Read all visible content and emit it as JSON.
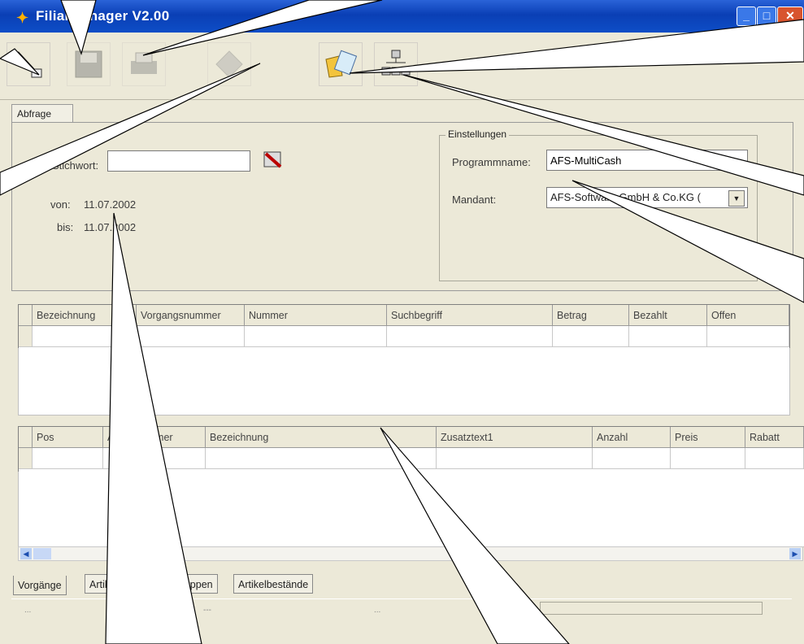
{
  "window": {
    "title": "Filialmanager V2.00"
  },
  "toolbar": {
    "items": [
      {
        "name": "Suchen",
        "icon": "magic-wand-icon",
        "disabled": false
      },
      {
        "name": "Speichern",
        "icon": "save-disk-icon",
        "disabled": true
      },
      {
        "name": "Drucken",
        "icon": "printer-icon",
        "disabled": true
      },
      {
        "name": "Abgleich",
        "icon": "exchange-icon",
        "disabled": true
      },
      {
        "name": "Import",
        "icon": "folder-document-icon",
        "disabled": false
      },
      {
        "name": "Filialen",
        "icon": "network-icon",
        "disabled": false
      }
    ]
  },
  "query": {
    "tab_label": "Abfrage",
    "keyword_label": "Stichwort:",
    "keyword_value": "",
    "von_label": "von:",
    "von_value": "11.07.2002",
    "bis_label": "bis:",
    "bis_value": "11.07.2002"
  },
  "settings": {
    "group_title": "Einstellungen",
    "program_label": "Programmname:",
    "program_value": "AFS-MultiCash",
    "mandant_label": "Mandant:",
    "mandant_value": "AFS-Software GmbH & Co.KG ("
  },
  "grid_top": {
    "columns": [
      "Bezeichnung",
      "Vorgangsnummer",
      "Nummer",
      "Suchbegriff",
      "Betrag",
      "Bezahlt",
      "Offen"
    ]
  },
  "grid_bottom": {
    "columns": [
      "Pos",
      "Artikelnummer",
      "Bezeichnung",
      "Zusatztext1",
      "Anzahl",
      "Preis",
      "Rabatt"
    ]
  },
  "bottom_tabs": [
    "Vorgänge",
    "Artikel",
    "Artikelgruppen",
    "Artikelbestände"
  ],
  "status": {
    "left": "...",
    "mid": "---",
    "mid2": "..."
  }
}
